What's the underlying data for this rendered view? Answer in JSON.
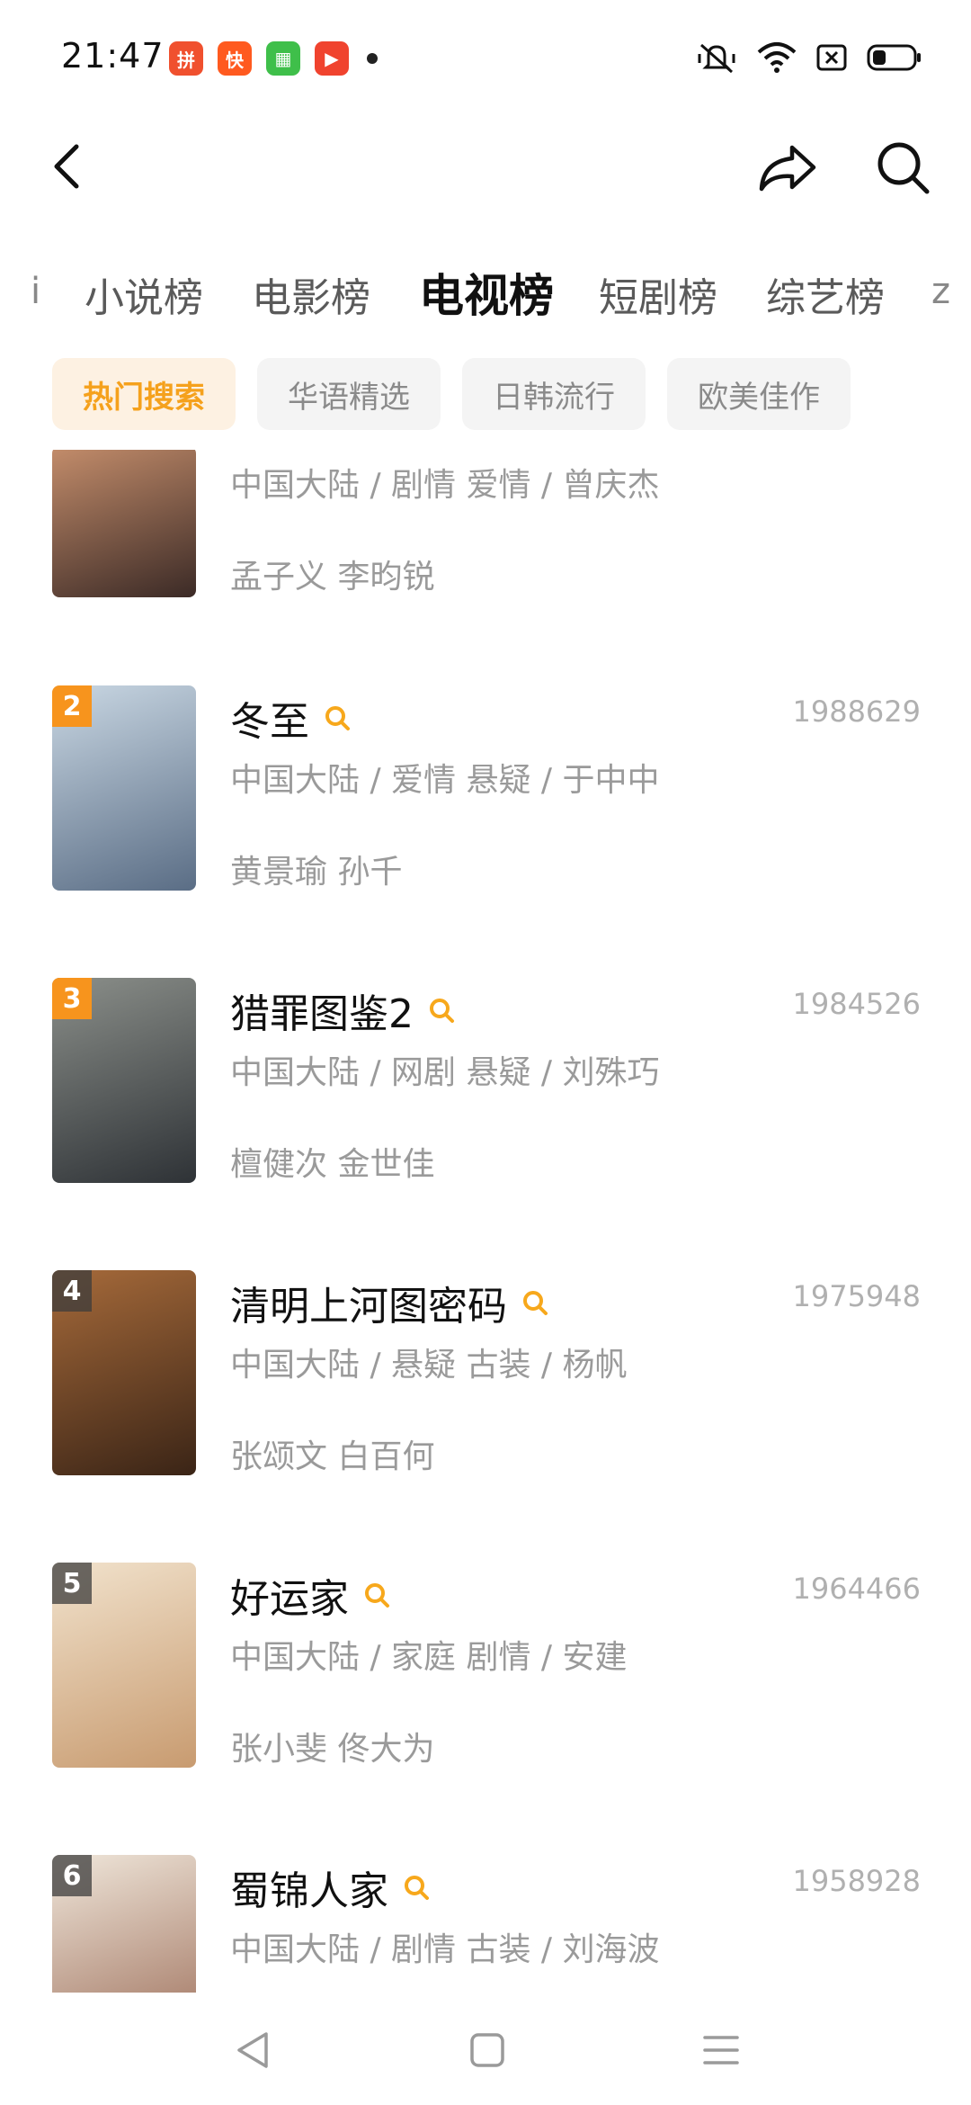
{
  "status_bar": {
    "time": "21:47",
    "app_icons": [
      {
        "name": "pdd-app-icon",
        "color": "#f0502e",
        "glyph": "拼"
      },
      {
        "name": "kuaishou-app-icon",
        "color": "#ff5a1f",
        "glyph": "快"
      },
      {
        "name": "store-app-icon",
        "color": "#3fbf4a",
        "glyph": "▦"
      },
      {
        "name": "video-app-icon",
        "color": "#f0432e",
        "glyph": "▶"
      }
    ]
  },
  "header": {
    "back_icon": "chevron-left-icon",
    "share_icon": "share-icon",
    "search_icon": "search-icon"
  },
  "category_tabs": {
    "left_edge": "ⅰ",
    "items": [
      "小说榜",
      "电影榜",
      "电视榜",
      "短剧榜",
      "综艺榜"
    ],
    "active_index": 2,
    "right_edge": "z"
  },
  "chips": {
    "items": [
      "热门搜索",
      "华语精选",
      "日韩流行",
      "欧美佳作"
    ],
    "active_index": 0
  },
  "list": {
    "items": [
      {
        "rank": "",
        "title": "",
        "count": "",
        "meta": "中国大陆 / 剧情 爱情 / 曾庆杰",
        "actors": "孟子义 李昀锐",
        "poster_colors": [
          "#c48d6b",
          "#3b2a26"
        ]
      },
      {
        "rank": "2",
        "title": "冬至",
        "count": "1988629",
        "meta": "中国大陆 / 爱情 悬疑 / 于中中",
        "actors": "黄景瑜 孙千",
        "poster_colors": [
          "#c9d7e3",
          "#5a6d85"
        ]
      },
      {
        "rank": "3",
        "title": "猎罪图鉴2",
        "count": "1984526",
        "meta": "中国大陆 / 网剧 悬疑 / 刘殊巧",
        "actors": "檀健次 金世佳",
        "poster_colors": [
          "#8b8f8a",
          "#2e3236"
        ]
      },
      {
        "rank": "4",
        "title": "清明上河图密码",
        "count": "1975948",
        "meta": "中国大陆 / 悬疑 古装 / 杨帆",
        "actors": "张颂文 白百何",
        "poster_colors": [
          "#a66a3a",
          "#3a2416"
        ]
      },
      {
        "rank": "5",
        "title": "好运家",
        "count": "1964466",
        "meta": "中国大陆 / 家庭 剧情 / 安建",
        "actors": "张小斐 佟大为",
        "poster_colors": [
          "#f1e2cc",
          "#c89b70"
        ]
      },
      {
        "rank": "6",
        "title": "蜀锦人家",
        "count": "1958928",
        "meta": "中国大陆 / 剧情 古装 / 刘海波",
        "actors": "",
        "poster_colors": [
          "#efe6da",
          "#9a6a55"
        ]
      }
    ]
  },
  "colors": {
    "accent": "#f7941d",
    "chip_active_bg": "#fdf1e2",
    "text_secondary": "#9a9a9a"
  }
}
